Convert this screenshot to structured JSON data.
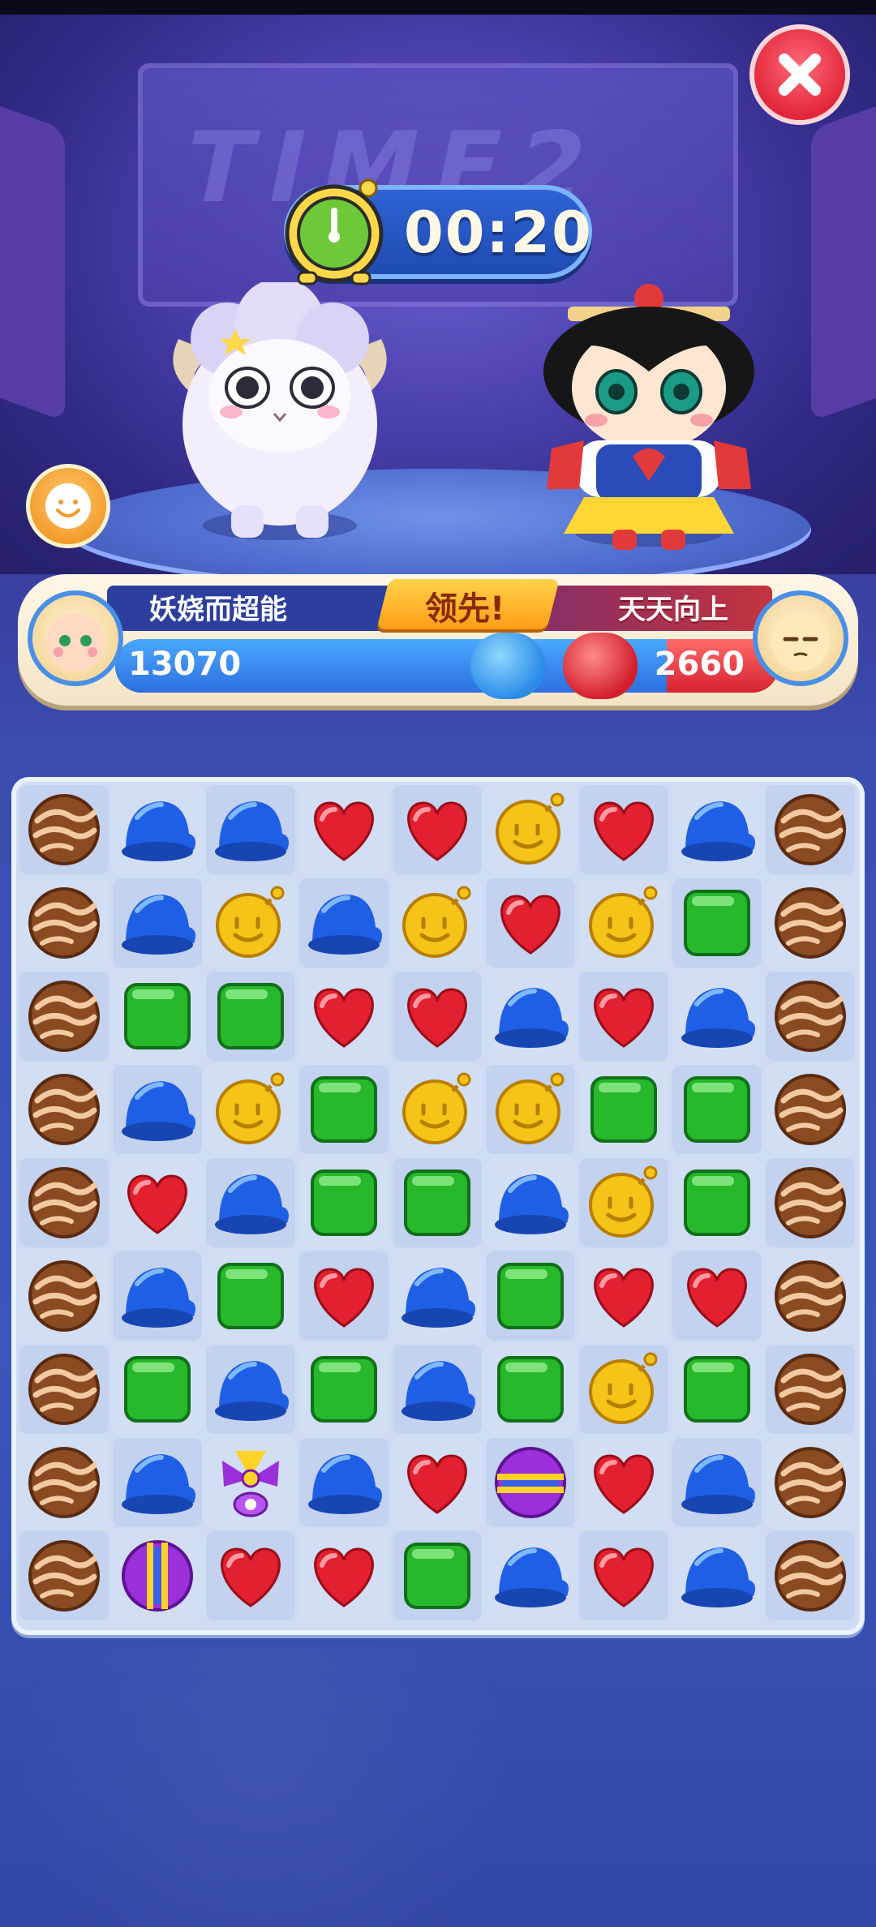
{
  "timer": "00:20",
  "players": {
    "left": {
      "name": "妖娆而超能",
      "score": "13070",
      "score_value": 13070
    },
    "right": {
      "name": "天天向上",
      "score": "2660",
      "score_value": 2660
    }
  },
  "lead_label": "领先!",
  "arena_sign": "TIME2",
  "colors": {
    "blue_team": "#2e6fe0",
    "red_team": "#d62330",
    "lead_tag": "#ffb21f"
  },
  "board": {
    "rows": 9,
    "cols": 9,
    "cells": [
      [
        "chocolate",
        "blue-hat",
        "blue-hat",
        "red-heart",
        "red-heart",
        "yellow-bomb",
        "red-heart",
        "blue-hat",
        "chocolate"
      ],
      [
        "chocolate",
        "blue-hat",
        "yellow-bomb",
        "blue-hat",
        "yellow-bomb",
        "red-heart",
        "yellow-bomb",
        "green-cube",
        "chocolate"
      ],
      [
        "chocolate",
        "green-cube",
        "green-cube",
        "red-heart",
        "red-heart",
        "blue-hat",
        "red-heart",
        "blue-hat",
        "chocolate"
      ],
      [
        "chocolate",
        "blue-hat",
        "yellow-bomb",
        "green-cube",
        "yellow-bomb",
        "yellow-bomb",
        "green-cube",
        "green-cube",
        "chocolate"
      ],
      [
        "chocolate",
        "red-heart",
        "blue-hat",
        "green-cube",
        "green-cube",
        "blue-hat",
        "yellow-bomb",
        "green-cube",
        "chocolate"
      ],
      [
        "chocolate",
        "blue-hat",
        "green-cube",
        "red-heart",
        "blue-hat",
        "green-cube",
        "red-heart",
        "red-heart",
        "chocolate"
      ],
      [
        "chocolate",
        "green-cube",
        "blue-hat",
        "green-cube",
        "blue-hat",
        "green-cube",
        "yellow-bomb",
        "green-cube",
        "chocolate"
      ],
      [
        "chocolate",
        "blue-hat",
        "purple-propeller",
        "blue-hat",
        "red-heart",
        "purple-striped-h",
        "red-heart",
        "blue-hat",
        "chocolate"
      ],
      [
        "chocolate",
        "purple-striped-v",
        "red-heart",
        "red-heart",
        "green-cube",
        "blue-hat",
        "red-heart",
        "blue-hat",
        "chocolate"
      ]
    ]
  }
}
